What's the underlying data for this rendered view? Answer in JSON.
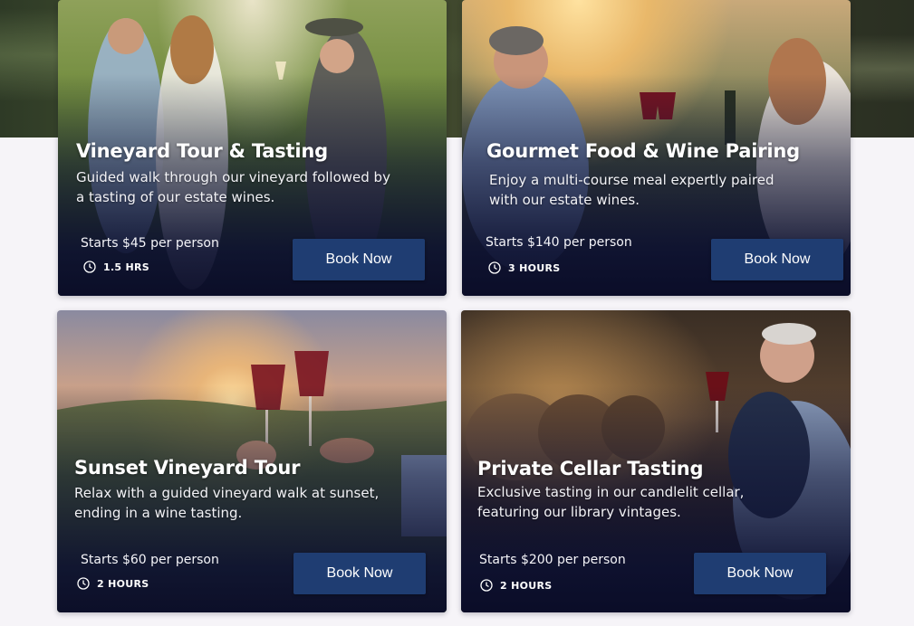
{
  "cards": [
    {
      "title": "Vineyard Tour & Tasting",
      "description_line1": "Guided walk through our vineyard followed by",
      "description_line2": "a tasting of our estate wines.",
      "price": "Starts $45 per person",
      "duration": "1.5 HRS",
      "button": "Book Now",
      "image": "couple-and-winemaker-in-vineyard"
    },
    {
      "title": "Gourmet Food & Wine Pairing",
      "description_line1": "Enjoy a multi-course meal expertly paired",
      "description_line2": "with our estate wines.",
      "price": "Starts $140 per person",
      "duration": "3 HOURS",
      "button": "Book Now",
      "image": "couple-toasting-at-sunset-dinner"
    },
    {
      "title": "Sunset Vineyard Tour",
      "description_line1": "Relax with a guided vineyard walk at sunset,",
      "description_line2": "ending in a wine tasting.",
      "price": "Starts $60 per person",
      "duration": "2 HOURS",
      "button": "Book Now",
      "image": "two-glasses-toasting-at-sunset"
    },
    {
      "title": "Private Cellar Tasting",
      "description_line1": "Exclusive tasting in our candlelit cellar,",
      "description_line2": "featuring our library vintages.",
      "price": "Starts $200 per person",
      "duration": "2 HOURS",
      "button": "Book Now",
      "image": "man-tasting-wine-in-barrel-cellar"
    }
  ],
  "icons": {
    "duration": "clock-icon"
  },
  "colors": {
    "button": "#1f3d72",
    "overlay": "#0e1234",
    "page_bg": "#f6f4f8"
  }
}
